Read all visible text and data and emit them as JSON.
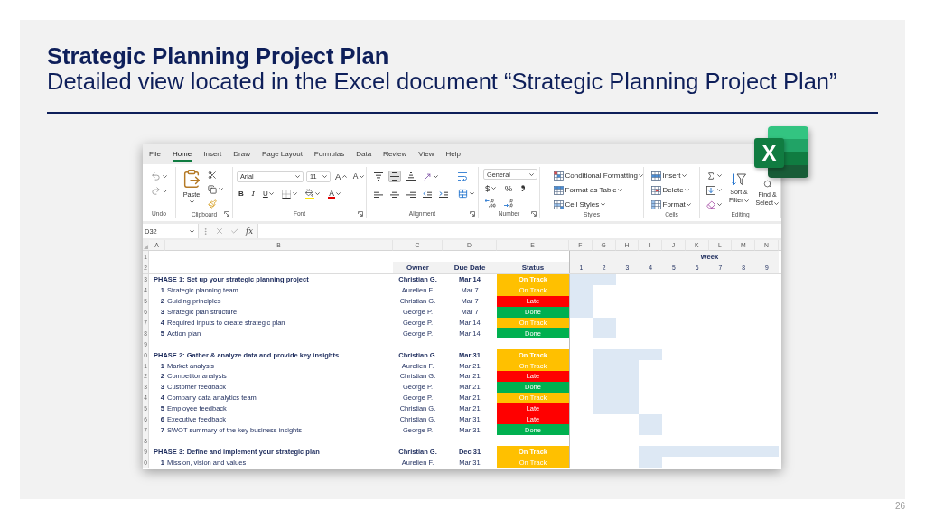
{
  "slide": {
    "title": "Strategic Planning Project Plan",
    "subtitle": "Detailed view located in the Excel document “Strategic Planning Project Plan”",
    "page_number": "26"
  },
  "app_logo": {
    "letter": "X"
  },
  "menu_tabs": [
    {
      "label": "File",
      "selected": false
    },
    {
      "label": "Home",
      "selected": true
    },
    {
      "label": "Insert",
      "selected": false
    },
    {
      "label": "Draw",
      "selected": false
    },
    {
      "label": "Page Layout",
      "selected": false
    },
    {
      "label": "Formulas",
      "selected": false
    },
    {
      "label": "Data",
      "selected": false
    },
    {
      "label": "Review",
      "selected": false
    },
    {
      "label": "View",
      "selected": false
    },
    {
      "label": "Help",
      "selected": false
    }
  ],
  "ribbon": {
    "undo": {
      "label": "Undo"
    },
    "clipboard": {
      "paste": "Paste",
      "label": "Clipboard"
    },
    "font": {
      "font_name": "Arial",
      "font_size": "11",
      "grow": "A",
      "shrink": "A",
      "bold": "B",
      "italic": "I",
      "underline": "U",
      "font_color": "A",
      "label": "Font"
    },
    "alignment": {
      "vertical": [
        {
          "kind": "top",
          "selected": false
        },
        {
          "kind": "middle",
          "selected": true
        },
        {
          "kind": "bottom",
          "selected": false
        }
      ],
      "label": "Alignment"
    },
    "number": {
      "format": "General",
      "currency": "$",
      "percent": "%",
      "label": "Number"
    },
    "styles": {
      "items": [
        {
          "kind": "conditional",
          "label": "Conditional Formatting"
        },
        {
          "kind": "table",
          "label": "Format as Table"
        },
        {
          "kind": "cell",
          "label": "Cell Styles"
        }
      ],
      "label": "Styles"
    },
    "cells": {
      "items": [
        {
          "kind": "insert",
          "label": "Insert"
        },
        {
          "kind": "delete",
          "label": "Delete"
        },
        {
          "kind": "format",
          "label": "Format"
        }
      ],
      "label": "Cells"
    },
    "editing": {
      "sort": "Sort & Filter",
      "find": "Find & Select",
      "label": "Editing"
    }
  },
  "formula_bar": {
    "name_box": "D32",
    "function_label": "fx"
  },
  "sheet": {
    "column_letters": [
      "A",
      "B",
      "C",
      "D",
      "E",
      "F",
      "G",
      "H",
      "I",
      "J",
      "K",
      "L",
      "M",
      "N"
    ],
    "row_numbers": [
      "1",
      "2",
      "3",
      "4",
      "5",
      "6",
      "7",
      "8",
      "9",
      "0",
      "1",
      "2",
      "3",
      "4",
      "5",
      "6",
      "7",
      "8",
      "9",
      "0"
    ],
    "week_header": "Week",
    "column_titles": [
      "Owner",
      "Due Date",
      "Status"
    ],
    "week_numbers": [
      "1",
      "2",
      "3",
      "4",
      "5",
      "6",
      "7",
      "8",
      "9"
    ],
    "rows": [
      {
        "kind": "phase",
        "title": "PHASE 1: Set up your strategic planning project",
        "owner": "Christian G.",
        "due": "Mar 14",
        "status": "On Track",
        "color": "#ffc000",
        "timeline": [
          true,
          true,
          false,
          false,
          false,
          false,
          false,
          false,
          false
        ]
      },
      {
        "kind": "task",
        "number": "1",
        "title": "Strategic planning team",
        "owner": "Aurelien F.",
        "due": "Mar 7",
        "status": "On Track",
        "color": "#ffc000",
        "timeline": [
          true,
          false,
          false,
          false,
          false,
          false,
          false,
          false,
          false
        ]
      },
      {
        "kind": "task",
        "number": "2",
        "title": "Guiding principles",
        "owner": "Christian G.",
        "due": "Mar 7",
        "status": "Late",
        "color": "#ff0000",
        "timeline": [
          true,
          false,
          false,
          false,
          false,
          false,
          false,
          false,
          false
        ]
      },
      {
        "kind": "task",
        "number": "3",
        "title": "Strategic plan structure",
        "owner": "George P.",
        "due": "Mar 7",
        "status": "Done",
        "color": "#00b050",
        "timeline": [
          true,
          false,
          false,
          false,
          false,
          false,
          false,
          false,
          false
        ]
      },
      {
        "kind": "task",
        "number": "4",
        "title": "Required inputs to create strategic plan",
        "owner": "George P.",
        "due": "Mar 14",
        "status": "On Track",
        "color": "#ffc000",
        "timeline": [
          false,
          true,
          false,
          false,
          false,
          false,
          false,
          false,
          false
        ]
      },
      {
        "kind": "task",
        "number": "5",
        "title": "Action plan",
        "owner": "George P.",
        "due": "Mar 14",
        "status": "Done",
        "color": "#00b050",
        "timeline": [
          false,
          true,
          false,
          false,
          false,
          false,
          false,
          false,
          false
        ]
      },
      {
        "kind": "blank"
      },
      {
        "kind": "phase",
        "title": "PHASE 2: Gather & analyze data and provide key insights",
        "owner": "Christian G.",
        "due": "Mar 31",
        "status": "On Track",
        "color": "#ffc000",
        "timeline": [
          false,
          true,
          true,
          true,
          false,
          false,
          false,
          false,
          false
        ]
      },
      {
        "kind": "task",
        "number": "1",
        "title": "Market analysis",
        "owner": "Aurelien F.",
        "due": "Mar 21",
        "status": "On Track",
        "color": "#ffc000",
        "timeline": [
          false,
          true,
          true,
          false,
          false,
          false,
          false,
          false,
          false
        ]
      },
      {
        "kind": "task",
        "number": "2",
        "title": "Competitor analysis",
        "owner": "Christian G.",
        "due": "Mar 21",
        "status": "Late",
        "color": "#ff0000",
        "timeline": [
          false,
          true,
          true,
          false,
          false,
          false,
          false,
          false,
          false
        ]
      },
      {
        "kind": "task",
        "number": "3",
        "title": "Customer feedback",
        "owner": "George P.",
        "due": "Mar 21",
        "status": "Done",
        "color": "#00b050",
        "timeline": [
          false,
          true,
          true,
          false,
          false,
          false,
          false,
          false,
          false
        ]
      },
      {
        "kind": "task",
        "number": "4",
        "title": "Company data analytics team",
        "owner": "George P.",
        "due": "Mar 21",
        "status": "On Track",
        "color": "#ffc000",
        "timeline": [
          false,
          true,
          true,
          false,
          false,
          false,
          false,
          false,
          false
        ]
      },
      {
        "kind": "task",
        "number": "5",
        "title": "Employee feedback",
        "owner": "Christian G.",
        "due": "Mar 21",
        "status": "Late",
        "color": "#ff0000",
        "timeline": [
          false,
          true,
          true,
          false,
          false,
          false,
          false,
          false,
          false
        ]
      },
      {
        "kind": "task",
        "number": "6",
        "title": "Executive feedback",
        "owner": "Christian G.",
        "due": "Mar 31",
        "status": "Late",
        "color": "#ff0000",
        "timeline": [
          false,
          false,
          false,
          true,
          false,
          false,
          false,
          false,
          false
        ]
      },
      {
        "kind": "task",
        "number": "7",
        "title": "SWOT summary of the key business insights",
        "owner": "George P.",
        "due": "Mar 31",
        "status": "Done",
        "color": "#00b050",
        "timeline": [
          false,
          false,
          false,
          true,
          false,
          false,
          false,
          false,
          false
        ]
      },
      {
        "kind": "blank"
      },
      {
        "kind": "phase",
        "title": "PHASE 3: Define and implement your strategic plan",
        "owner": "Christian G.",
        "due": "Dec 31",
        "status": "On Track",
        "color": "#ffc000",
        "timeline": [
          false,
          false,
          false,
          true,
          true,
          true,
          true,
          true,
          true
        ]
      },
      {
        "kind": "task",
        "number": "1",
        "title": "Mission, vision and values",
        "owner": "Aurelien F.",
        "due": "Mar 31",
        "status": "On Track",
        "color": "#ffc000",
        "timeline": [
          false,
          false,
          false,
          true,
          false,
          false,
          false,
          false,
          false
        ]
      }
    ]
  }
}
